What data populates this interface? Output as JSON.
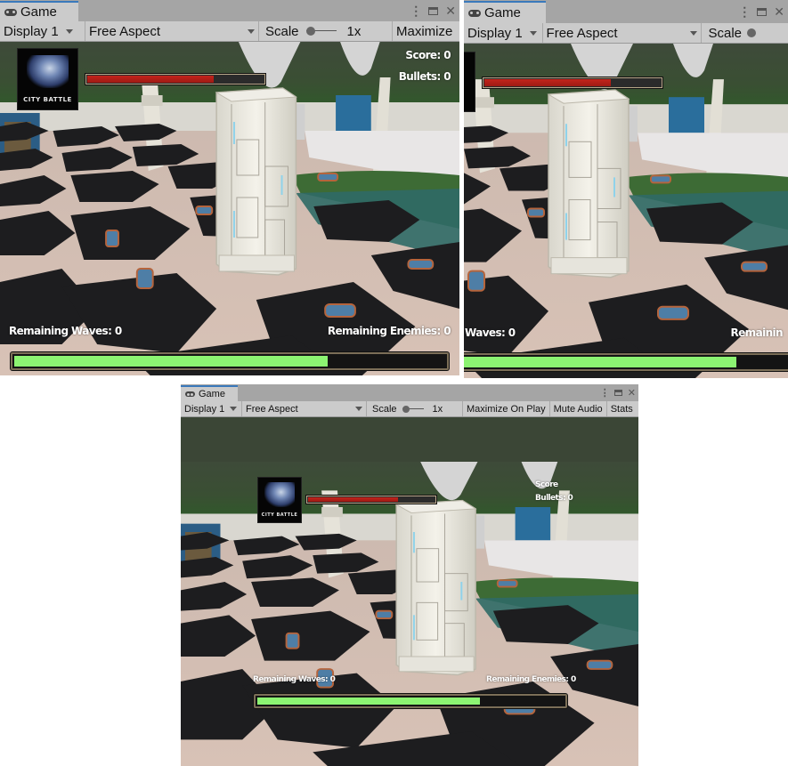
{
  "panels": [
    {
      "id": "panel-1",
      "tab_label": "Game",
      "toolbar": {
        "display": "Display 1",
        "aspect": "Free Aspect",
        "scale_label": "Scale",
        "scale_value": "1x",
        "maximize": "Maximize"
      },
      "hud": {
        "logo_title": "CITY BATTLE",
        "health_fraction": 0.73,
        "score": "Score: 0",
        "bullets": "Bullets: 0",
        "remaining_waves": "Remaining Waves: 0",
        "remaining_enemies": "Remaining Enemies: 0",
        "wave_progress_fraction": 0.73
      }
    },
    {
      "id": "panel-2",
      "tab_label": "Game",
      "toolbar": {
        "display": "Display 1",
        "aspect": "Free Aspect",
        "scale_label": "Scale"
      },
      "hud": {
        "health_fraction": 0.73,
        "remaining_waves": "Waves: 0",
        "remaining_enemies": "Remainin",
        "wave_progress_fraction": 0.82
      }
    },
    {
      "id": "panel-3",
      "tab_label": "Game",
      "toolbar": {
        "display": "Display 1",
        "aspect": "Free Aspect",
        "scale_label": "Scale",
        "scale_value": "1x",
        "maximize_on_play": "Maximize On Play",
        "mute_audio": "Mute Audio",
        "stats": "Stats"
      },
      "hud": {
        "logo_title": "CITY BATTLE",
        "health_fraction": 0.73,
        "score": "Score",
        "bullets": "Bullets: 0",
        "remaining_waves": "Remaining Waves: 0",
        "remaining_enemies": "Remaining Enemies: 0",
        "wave_progress_fraction": 0.73
      }
    }
  ],
  "icons": {
    "tab": "gamepad-icon",
    "menu": "more-vert-icon",
    "maximize": "maximize-window-icon",
    "close": "close-icon",
    "dropdown": "chevron-down-icon"
  },
  "colors": {
    "health": "#b8221a",
    "wave_progress": "#8cf472",
    "tab_accent": "#3a79bb"
  }
}
